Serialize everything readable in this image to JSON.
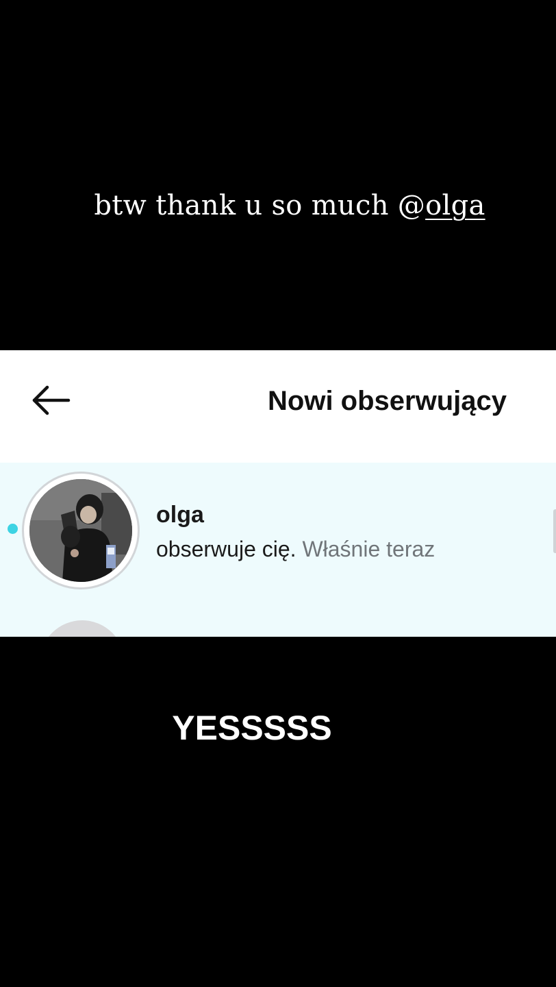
{
  "story": {
    "top_caption": {
      "prefix": "btw thank u so much",
      "at": "@",
      "mention": "olga"
    },
    "bottom_caption": "YESSSSS"
  },
  "screen": {
    "header": {
      "back_icon": "arrow-left-icon",
      "title": "Nowi obserwujący"
    },
    "notifications": [
      {
        "username": "olga",
        "action": "obserwuje cię.",
        "time": "Właśnie teraz",
        "unread": true,
        "avatar": "profile-photo"
      }
    ]
  },
  "colors": {
    "unread_dot": "#3dd3e3",
    "row_highlight": "#eefbfd",
    "time_text": "#707579"
  }
}
